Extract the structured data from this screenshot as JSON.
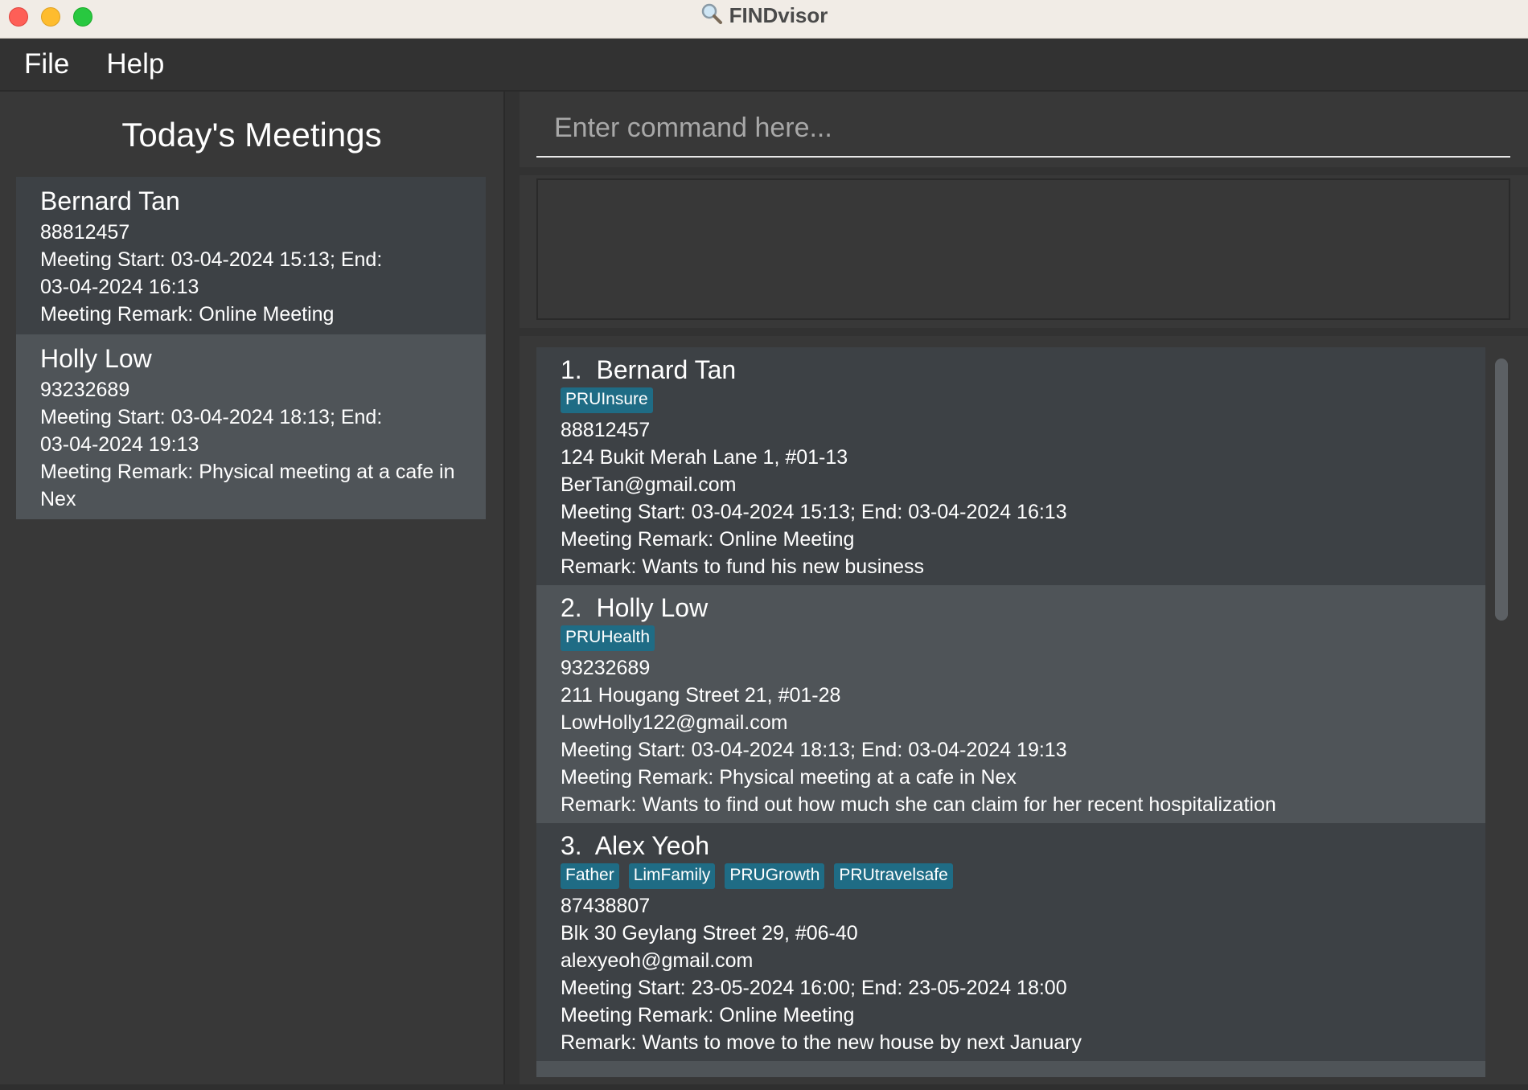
{
  "window": {
    "title": "FINDvisor"
  },
  "menu": {
    "items": [
      "File",
      "Help"
    ]
  },
  "today_meetings": {
    "heading": "Today's Meetings",
    "items": [
      {
        "name": "Bernard Tan",
        "phone": "88812457",
        "meeting_line1": "Meeting Start: 03-04-2024 15:13; End:",
        "meeting_line2": "03-04-2024 16:13",
        "remark_line1": "Meeting Remark: Online Meeting",
        "remark_line2": ""
      },
      {
        "name": "Holly Low",
        "phone": "93232689",
        "meeting_line1": "Meeting Start: 03-04-2024 18:13; End:",
        "meeting_line2": "03-04-2024 19:13",
        "remark_line1": "Meeting Remark: Physical meeting at a cafe in",
        "remark_line2": "Nex"
      }
    ]
  },
  "command": {
    "placeholder": "Enter command here...",
    "value": ""
  },
  "result_display": {
    "text": ""
  },
  "persons": [
    {
      "index": "1.",
      "name": "Bernard Tan",
      "tags": [
        "PRUInsure"
      ],
      "phone": "88812457",
      "address": "124 Bukit Merah Lane 1, #01-13",
      "email": "BerTan@gmail.com",
      "meeting": "Meeting Start: 03-04-2024 15:13; End: 03-04-2024 16:13",
      "meeting_remark": "Meeting Remark: Online Meeting",
      "remark": "Remark: Wants to fund his new business"
    },
    {
      "index": "2.",
      "name": "Holly Low",
      "tags": [
        "PRUHealth"
      ],
      "phone": "93232689",
      "address": "211 Hougang Street 21, #01-28",
      "email": "LowHolly122@gmail.com",
      "meeting": "Meeting Start: 03-04-2024 18:13; End: 03-04-2024 19:13",
      "meeting_remark": "Meeting Remark: Physical meeting at a cafe in Nex",
      "remark": "Remark: Wants to find out how much she can claim for her recent hospitalization"
    },
    {
      "index": "3.",
      "name": "Alex Yeoh",
      "tags": [
        "Father",
        "LimFamily",
        "PRUGrowth",
        "PRUtravelsafe"
      ],
      "phone": "87438807",
      "address": "Blk 30 Geylang Street 29, #06-40",
      "email": "alexyeoh@gmail.com",
      "meeting": "Meeting Start: 23-05-2024 16:00; End: 23-05-2024 18:00",
      "meeting_remark": "Meeting Remark: Online Meeting",
      "remark": "Remark: Wants to move to the new house by next January"
    }
  ],
  "scroll": {
    "visible_fraction": 0.37,
    "position": 0.0
  },
  "colors": {
    "tag_background": "#1f6c85",
    "card_dark": "#3d4145",
    "card_light": "#4f5458",
    "panel": "#383838"
  }
}
